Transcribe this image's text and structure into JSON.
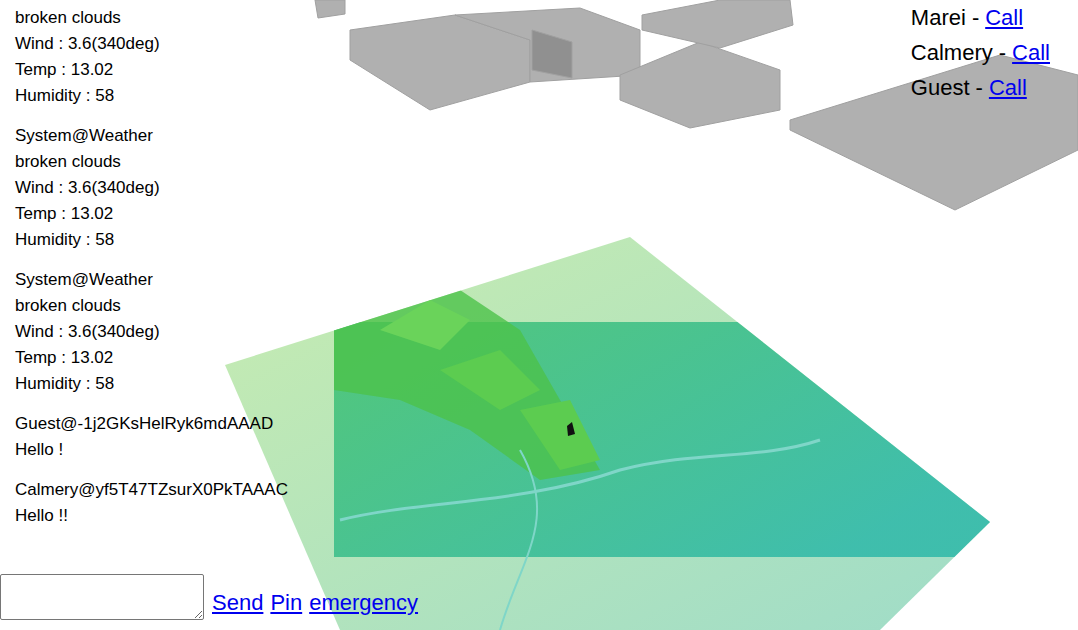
{
  "messages": [
    {
      "lines": [
        "broken clouds",
        "Wind : 3.6(340deg)",
        "Temp : 13.02",
        "Humidity : 58"
      ]
    },
    {
      "lines": [
        "System@Weather",
        "broken clouds",
        "Wind : 3.6(340deg)",
        "Temp : 13.02",
        "Humidity : 58"
      ]
    },
    {
      "lines": [
        "System@Weather",
        "broken clouds",
        "Wind : 3.6(340deg)",
        "Temp : 13.02",
        "Humidity : 58"
      ]
    },
    {
      "lines": [
        "Guest@-1j2GKsHelRyk6mdAAAD",
        "Hello !"
      ]
    },
    {
      "lines": [
        "Calmery@yf5T47TZsurX0PkTAAAC",
        "Hello !!"
      ]
    }
  ],
  "users": [
    {
      "name": "Marei",
      "separator": "-",
      "action": "Call"
    },
    {
      "name": "Calmery",
      "separator": "-",
      "action": "Call"
    },
    {
      "name": "Guest",
      "separator": "-",
      "action": "Call"
    }
  ],
  "composer": {
    "value": "",
    "buttons": [
      "Send",
      "Pin",
      "emergency"
    ]
  }
}
